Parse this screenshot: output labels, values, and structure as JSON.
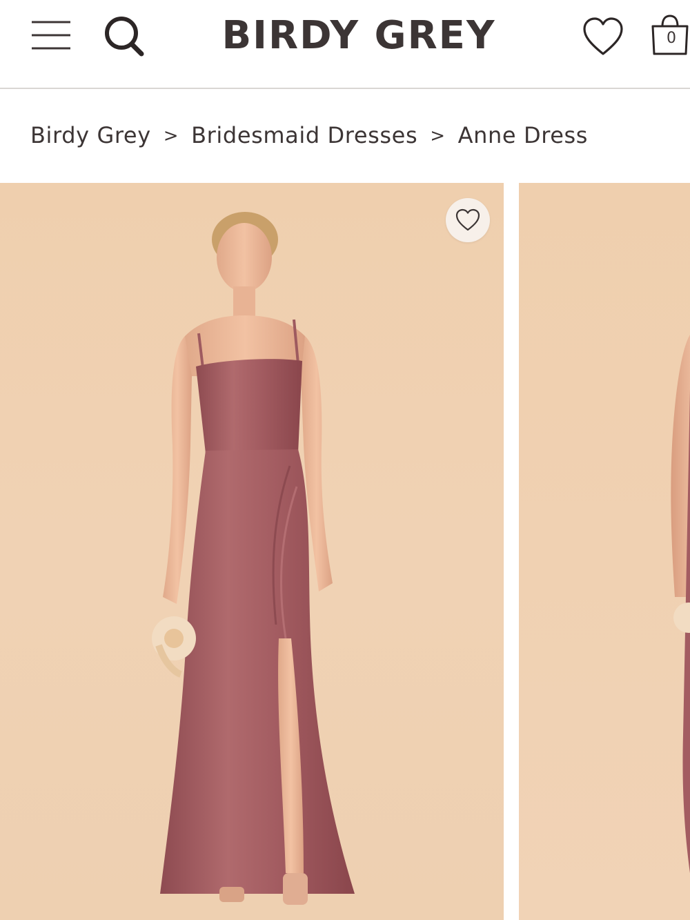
{
  "header": {
    "logo_text": "BIRDY GREY",
    "menu_icon": "hamburger-menu-icon",
    "search_icon": "search-icon",
    "wishlist_icon": "heart-icon",
    "cart_icon": "shopping-bag-icon",
    "cart_count": "0"
  },
  "breadcrumb": {
    "items": [
      {
        "label": "Birdy Grey"
      },
      {
        "label": "Bridesmaid Dresses"
      },
      {
        "label": "Anne Dress"
      }
    ],
    "separator": ">"
  },
  "gallery": {
    "favorite_icon": "heart-icon"
  },
  "colors": {
    "text": "#3c3535",
    "photo_background": "#efcfae",
    "dress": "#a45e62",
    "divider": "#d9d6d3"
  }
}
